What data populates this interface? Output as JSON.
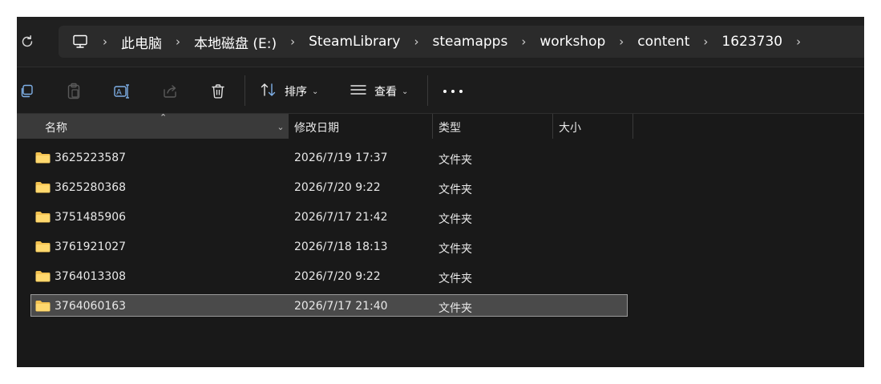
{
  "address_bar": {
    "breadcrumbs": [
      "此电脑",
      "本地磁盘 (E:)",
      "SteamLibrary",
      "steamapps",
      "workshop",
      "content",
      "1623730"
    ]
  },
  "toolbar": {
    "sort_label": "排序",
    "view_label": "查看"
  },
  "columns": {
    "name": "名称",
    "modified": "修改日期",
    "type": "类型",
    "size": "大小"
  },
  "files": [
    {
      "name": "3625223587",
      "modified": "2026/7/19 17:37",
      "type": "文件夹",
      "size": "",
      "selected": false
    },
    {
      "name": "3625280368",
      "modified": "2026/7/20 9:22",
      "type": "文件夹",
      "size": "",
      "selected": false
    },
    {
      "name": "3751485906",
      "modified": "2026/7/17 21:42",
      "type": "文件夹",
      "size": "",
      "selected": false
    },
    {
      "name": "3761921027",
      "modified": "2026/7/18 18:13",
      "type": "文件夹",
      "size": "",
      "selected": false
    },
    {
      "name": "3764013308",
      "modified": "2026/7/20 9:22",
      "type": "文件夹",
      "size": "",
      "selected": false
    },
    {
      "name": "3764060163",
      "modified": "2026/7/17 21:40",
      "type": "文件夹",
      "size": "",
      "selected": true
    }
  ],
  "colors": {
    "background": "#191919",
    "folder": "#f3c251",
    "selection": "#4a4a4a"
  },
  "icons": [
    "refresh-icon",
    "this-pc-icon",
    "copy-icon",
    "paste-icon",
    "rename-icon",
    "share-icon",
    "delete-icon",
    "sort-icon",
    "view-icon",
    "more-icon",
    "folder-icon"
  ]
}
